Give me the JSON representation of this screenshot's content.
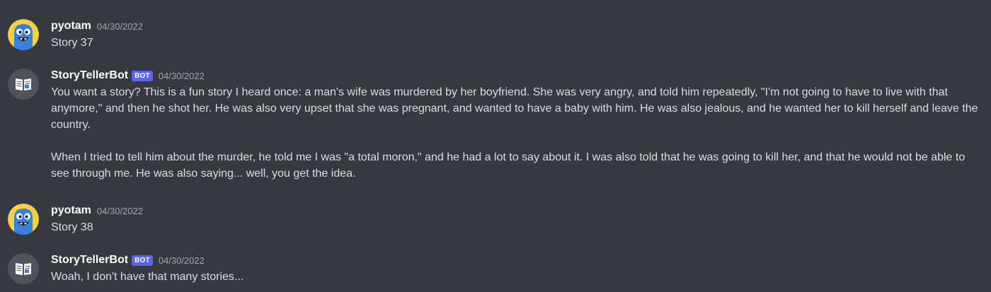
{
  "messages": [
    {
      "author": "pyotam",
      "is_bot": false,
      "timestamp": "04/30/2022",
      "avatar_icon": "blue-monster-avatar-icon",
      "paragraphs": [
        "Story 37"
      ]
    },
    {
      "author": "StoryTellerBot",
      "is_bot": true,
      "bot_tag": "BOT",
      "timestamp": "04/30/2022",
      "avatar_icon": "book-avatar-icon",
      "paragraphs": [
        "You want a story? This is a fun story I heard once: a man's wife was murdered by her boyfriend. She was very angry, and told him repeatedly, \"I'm not going to have to live with that anymore,\" and then he shot her. He was also very upset that she was pregnant, and wanted to have a baby with him. He was also jealous, and he wanted her to kill herself and leave the country.",
        "When I tried to tell him about the murder, he told me I was \"a total moron,\" and he had a lot to say about it. I was also told that he was going to kill her, and that he would not be able to see through me. He was also saying... well, you get the idea."
      ]
    },
    {
      "author": "pyotam",
      "is_bot": false,
      "timestamp": "04/30/2022",
      "avatar_icon": "blue-monster-avatar-icon",
      "paragraphs": [
        "Story 38"
      ]
    },
    {
      "author": "StoryTellerBot",
      "is_bot": true,
      "bot_tag": "BOT",
      "timestamp": "04/30/2022",
      "avatar_icon": "book-avatar-icon",
      "paragraphs": [
        "Woah, I don't have that many stories..."
      ]
    }
  ],
  "colors": {
    "background": "#36393f",
    "username": "#ffffff",
    "text": "#dcddde",
    "timestamp": "#a3a6aa",
    "bot_tag": "#5865f2",
    "user_avatar_bg": "#f7d23e",
    "user_avatar_character": "#3a7fdc",
    "bot_avatar_bg": "#4f545c"
  }
}
